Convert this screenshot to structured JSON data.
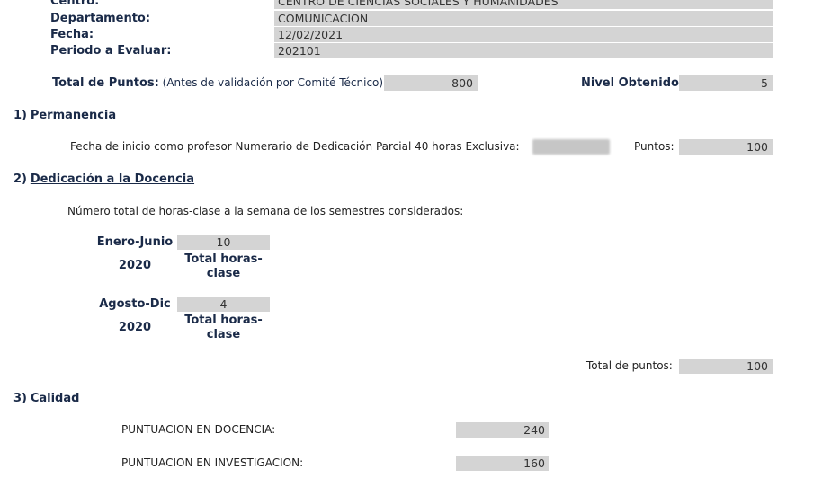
{
  "header": {
    "centro_label": "Centro:",
    "centro_value": "CENTRO DE CIENCIAS SOCIALES Y HUMANIDADES",
    "departamento_label": "Departamento:",
    "departamento_value": "COMUNICACION",
    "fecha_label": "Fecha:",
    "fecha_value": "12/02/2021",
    "periodo_label": "Periodo a Evaluar:",
    "periodo_value": "202101"
  },
  "totals": {
    "total_label": "Total de Puntos:",
    "total_note": "(Antes de validación por Comité Técnico)",
    "total_value": "800",
    "nivel_label": "Nivel Obtenido:",
    "nivel_value": "5"
  },
  "permanencia": {
    "number": "1)",
    "title": "Permanencia",
    "fecha_inicio_label": "Fecha de inicio como profesor Numerario de Dedicación Parcial 40 horas Exclusiva:",
    "puntos_label": "Puntos:",
    "puntos_value": "100"
  },
  "docencia": {
    "number": "2)",
    "title": "Dedicación a la Docencia",
    "intro": "Número total de horas-clase a la semana de los semestres considerados:",
    "semestres": [
      {
        "label_line1": "Enero-Junio",
        "label_line2": "2020",
        "value": "10",
        "unit_line1": "Total horas-",
        "unit_line2": "clase"
      },
      {
        "label_line1": "Agosto-Dic",
        "label_line2": "2020",
        "value": "4",
        "unit_line1": "Total horas-",
        "unit_line2": "clase"
      }
    ],
    "total_label": "Total de puntos:",
    "total_value": "100"
  },
  "calidad": {
    "number": "3)",
    "title": "Calidad",
    "docencia_label": "PUNTUACION EN DOCENCIA:",
    "docencia_value": "240",
    "investigacion_label": "PUNTUACION EN INVESTIGACION:",
    "investigacion_value": "160"
  }
}
